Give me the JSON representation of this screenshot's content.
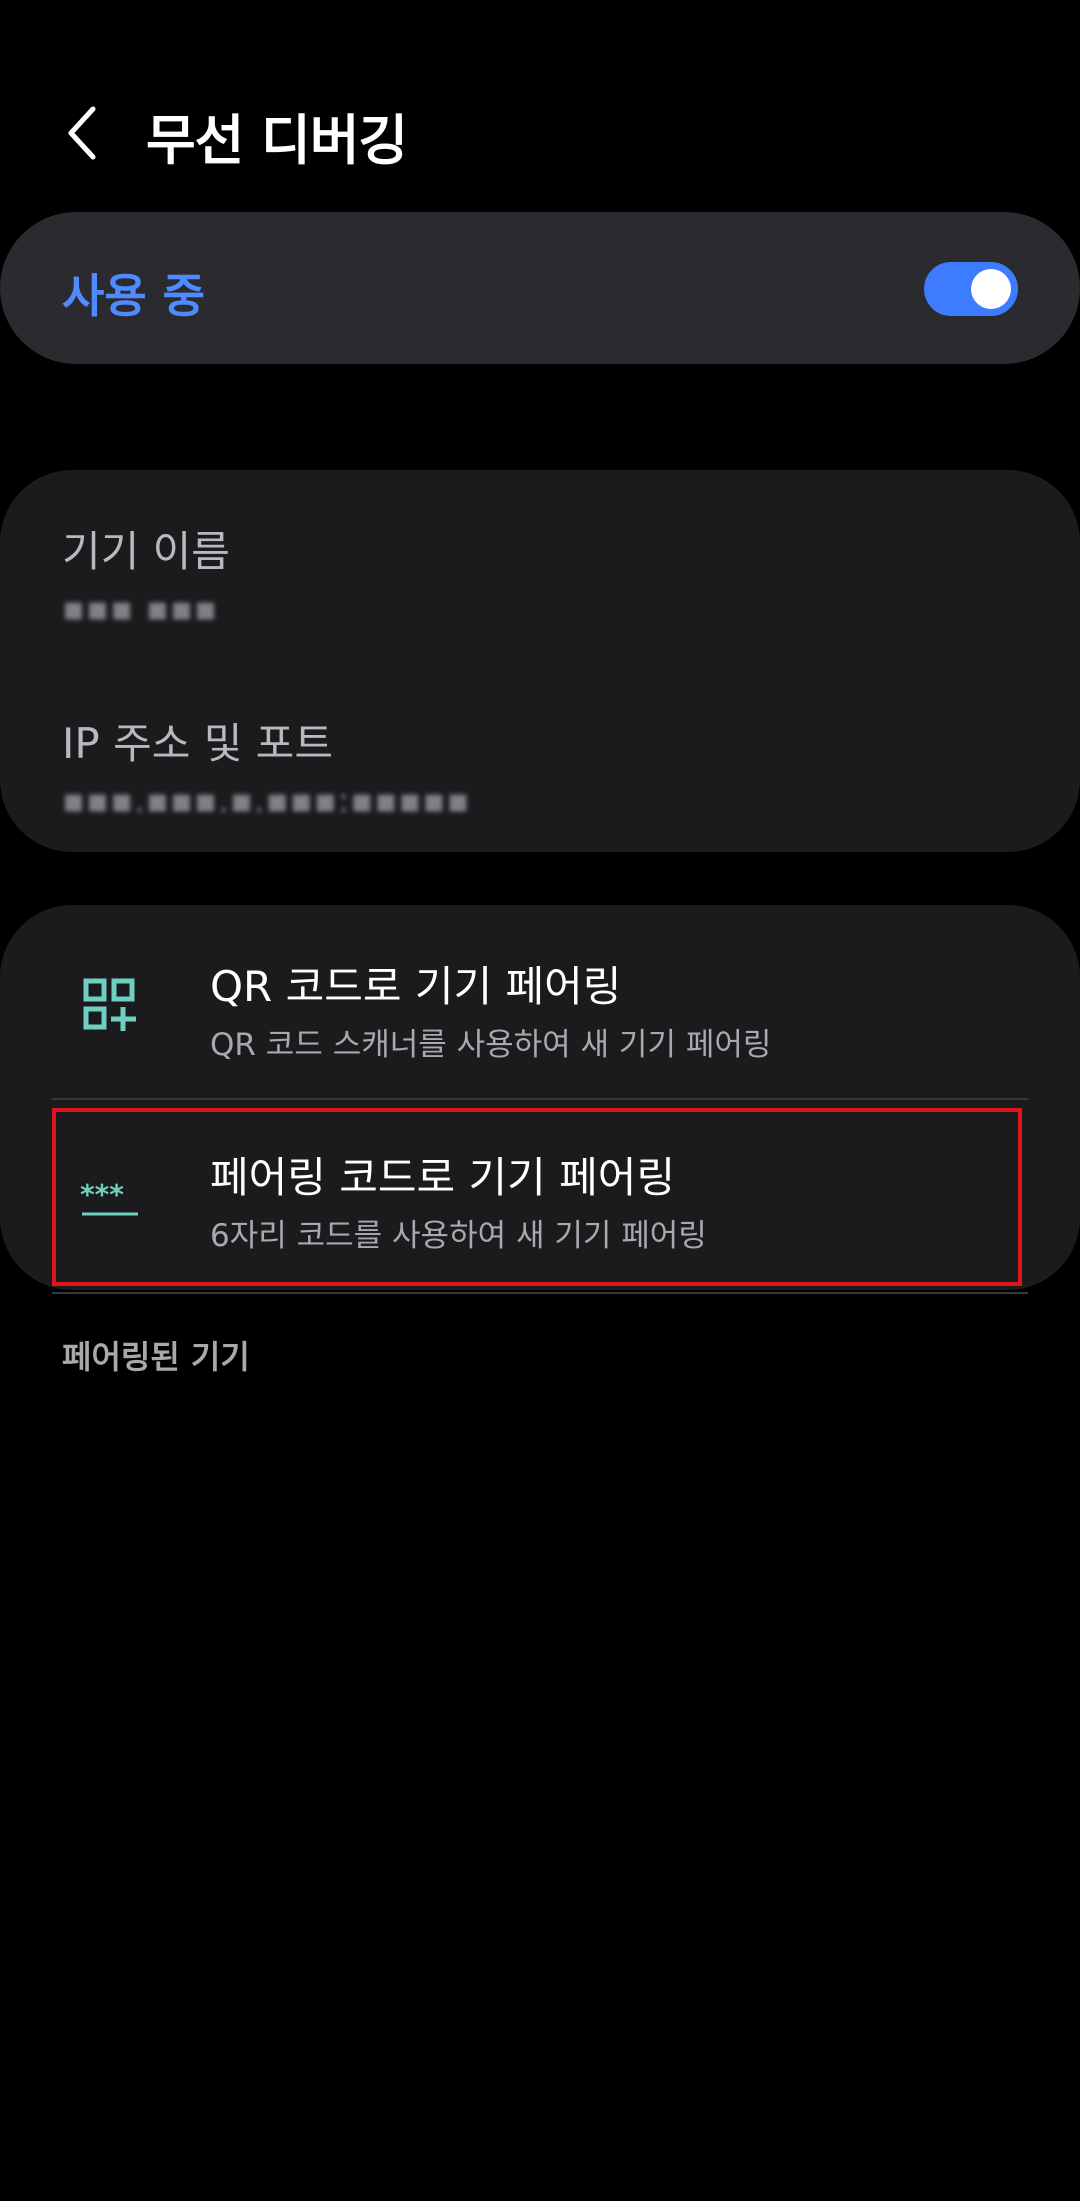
{
  "header": {
    "title": "무선 디버깅",
    "back_icon": "chevron-left-icon"
  },
  "toggle": {
    "label": "사용 중",
    "state": "on",
    "accent_color": "#4f8bff"
  },
  "info": {
    "device_name_title": "기기 이름",
    "device_name_value": "▪▪▪ ▪▪▪",
    "ip_title": "IP 주소 및 포트",
    "ip_value": "▪▪▪.▪▪▪.▪.▪▪▪:▪▪▪▪▪"
  },
  "pairing": {
    "qr": {
      "icon": "qr-code-icon",
      "title": "QR 코드로 기기 페어링",
      "subtitle": "QR 코드 스캐너를 사용하여 새 기기 페어링"
    },
    "code": {
      "icon": "pairing-code-icon",
      "title": "페어링 코드로 기기 페어링",
      "subtitle": "6자리 코드를 사용하여 새 기기 페어링"
    }
  },
  "paired_devices": {
    "header": "페어링된 기기"
  }
}
